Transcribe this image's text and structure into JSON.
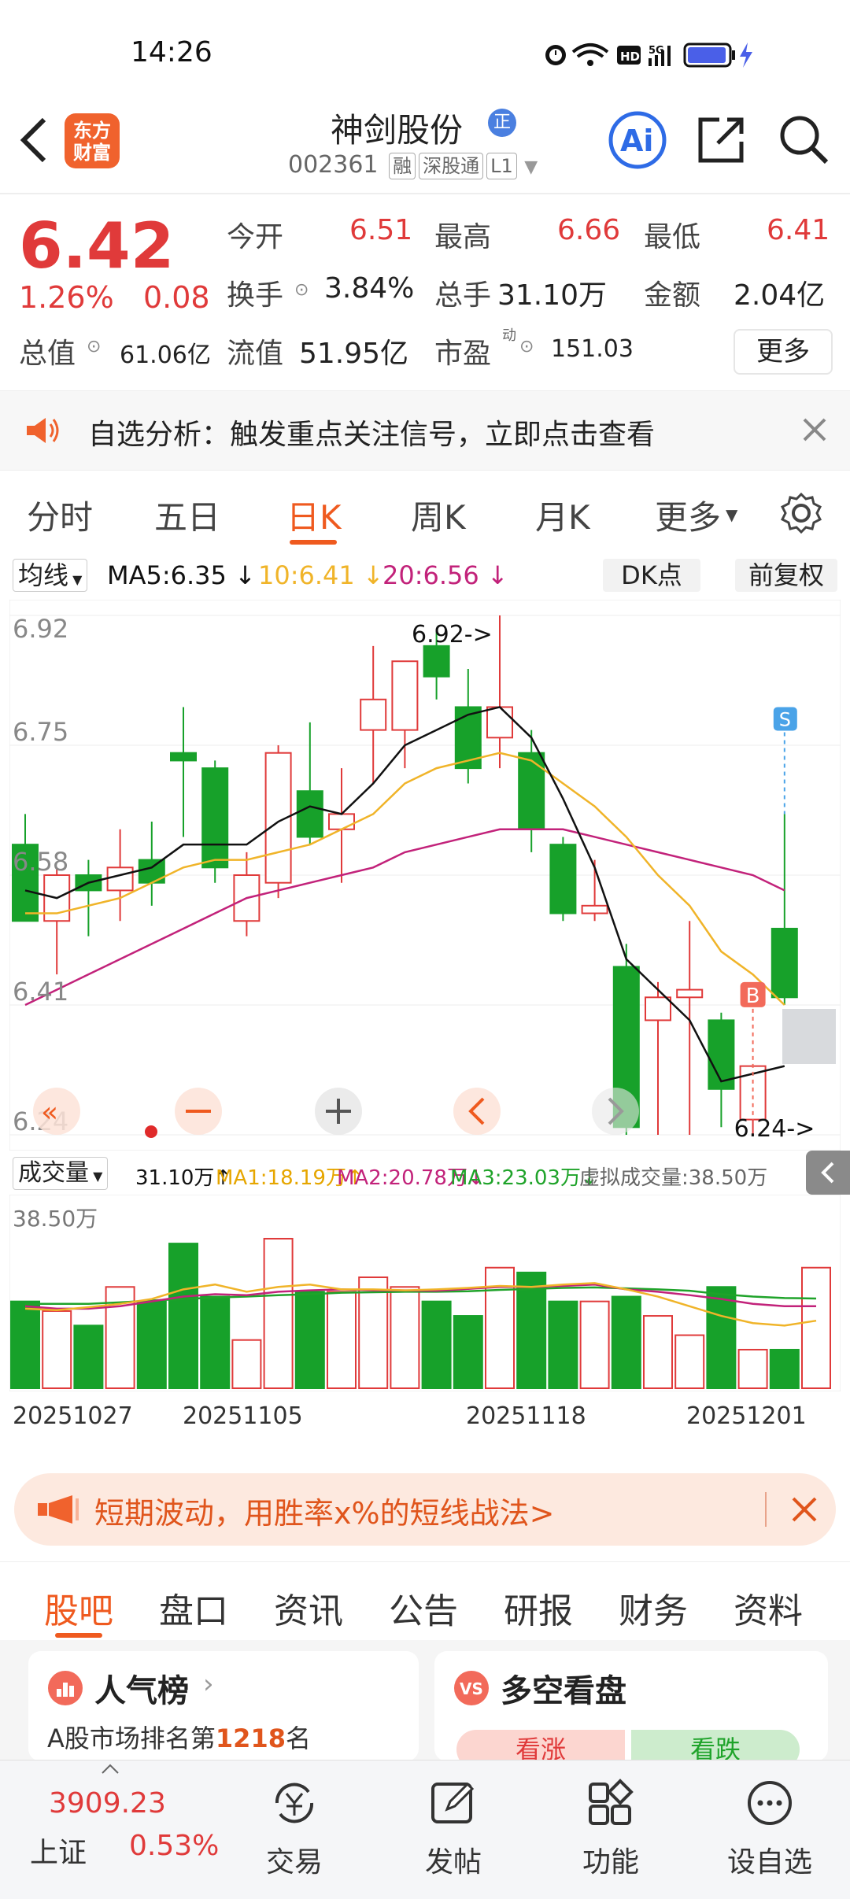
{
  "status_bar": {
    "time": "14:26"
  },
  "header": {
    "logo_text": "东方\n财富",
    "stock_name": "神剑股份",
    "badge": "正",
    "code": "002361",
    "tags": [
      "融",
      "深股通",
      "L1"
    ]
  },
  "quote": {
    "price": "6.42",
    "change_pct": "1.26%",
    "change_abs": "0.08",
    "open_label": "今开",
    "open": "6.51",
    "high_label": "最高",
    "high": "6.66",
    "low_label": "最低",
    "low": "6.41",
    "turnover_label": "换手",
    "turnover": "3.84%",
    "volume_label": "总手",
    "volume": "31.10万",
    "amount_label": "金额",
    "amount": "2.04亿",
    "mktcap_label": "总值",
    "mktcap": "61.06亿",
    "float_label": "流值",
    "float": "51.95亿",
    "pe_label": "市盈",
    "pe_sup": "动",
    "pe": "151.03",
    "more": "更多"
  },
  "banner": {
    "text": "自选分析：触发重点关注信号，立即点击查看"
  },
  "chart_tabs": [
    "分时",
    "五日",
    "日K",
    "周K",
    "月K",
    "更多"
  ],
  "ma_bar": {
    "selector": "均线",
    "ma5": "MA5:6.35",
    "ma10": "10:6.41",
    "ma20": "20:6.56",
    "dk": "DK点",
    "adjust": "前复权"
  },
  "chart_data": {
    "type": "candlestick",
    "y_ticks": [
      "6.92",
      "6.75",
      "6.58",
      "6.41",
      "6.24"
    ],
    "ylim": [
      6.24,
      6.92
    ],
    "annotations": {
      "high": "6.92->",
      "low": "6.24->",
      "buy": "B",
      "sell": "S"
    },
    "candles": [
      {
        "o": 6.62,
        "h": 6.66,
        "l": 6.55,
        "c": 6.52
      },
      {
        "o": 6.52,
        "h": 6.59,
        "l": 6.45,
        "c": 6.58
      },
      {
        "o": 6.58,
        "h": 6.6,
        "l": 6.5,
        "c": 6.56
      },
      {
        "o": 6.56,
        "h": 6.64,
        "l": 6.52,
        "c": 6.59
      },
      {
        "o": 6.6,
        "h": 6.65,
        "l": 6.54,
        "c": 6.57
      },
      {
        "o": 6.74,
        "h": 6.8,
        "l": 6.63,
        "c": 6.73
      },
      {
        "o": 6.72,
        "h": 6.73,
        "l": 6.57,
        "c": 6.59
      },
      {
        "o": 6.52,
        "h": 6.61,
        "l": 6.5,
        "c": 6.58
      },
      {
        "o": 6.57,
        "h": 6.75,
        "l": 6.55,
        "c": 6.74
      },
      {
        "o": 6.69,
        "h": 6.78,
        "l": 6.62,
        "c": 6.63
      },
      {
        "o": 6.64,
        "h": 6.72,
        "l": 6.57,
        "c": 6.66
      },
      {
        "o": 6.77,
        "h": 6.88,
        "l": 6.7,
        "c": 6.81
      },
      {
        "o": 6.77,
        "h": 6.85,
        "l": 6.72,
        "c": 6.86
      },
      {
        "o": 6.88,
        "h": 6.9,
        "l": 6.81,
        "c": 6.84
      },
      {
        "o": 6.8,
        "h": 6.85,
        "l": 6.7,
        "c": 6.72
      },
      {
        "o": 6.76,
        "h": 6.92,
        "l": 6.72,
        "c": 6.8
      },
      {
        "o": 6.74,
        "h": 6.77,
        "l": 6.61,
        "c": 6.64
      },
      {
        "o": 6.62,
        "h": 6.63,
        "l": 6.52,
        "c": 6.53
      },
      {
        "o": 6.53,
        "h": 6.6,
        "l": 6.52,
        "c": 6.54
      },
      {
        "o": 6.46,
        "h": 6.49,
        "l": 6.24,
        "c": 6.25
      },
      {
        "o": 6.39,
        "h": 6.44,
        "l": 6.24,
        "c": 6.42
      },
      {
        "o": 6.42,
        "h": 6.52,
        "l": 6.24,
        "c": 6.43
      },
      {
        "o": 6.39,
        "h": 6.4,
        "l": 6.25,
        "c": 6.3
      },
      {
        "o": 6.26,
        "h": 6.33,
        "l": 6.24,
        "c": 6.33
      },
      {
        "o": 6.51,
        "h": 6.66,
        "l": 6.41,
        "c": 6.42
      }
    ],
    "ma5": [
      6.56,
      6.55,
      6.57,
      6.58,
      6.59,
      6.62,
      6.62,
      6.62,
      6.65,
      6.67,
      6.66,
      6.7,
      6.75,
      6.77,
      6.79,
      6.8,
      6.76,
      6.68,
      6.59,
      6.47,
      6.43,
      6.39,
      6.31,
      6.32,
      6.33
    ],
    "ma10": [
      6.53,
      6.53,
      6.54,
      6.55,
      6.57,
      6.59,
      6.6,
      6.6,
      6.61,
      6.62,
      6.64,
      6.66,
      6.7,
      6.72,
      6.73,
      6.74,
      6.73,
      6.7,
      6.67,
      6.63,
      6.58,
      6.54,
      6.48,
      6.45,
      6.41
    ],
    "ma20": [
      6.41,
      6.43,
      6.45,
      6.47,
      6.49,
      6.51,
      6.53,
      6.55,
      6.56,
      6.57,
      6.58,
      6.59,
      6.61,
      6.62,
      6.63,
      6.64,
      6.64,
      6.64,
      6.63,
      6.62,
      6.61,
      6.6,
      6.59,
      6.58,
      6.56
    ],
    "volume": {
      "label": "成交量",
      "current": "31.10万",
      "ma1": "MA1:18.19万",
      "ma2": "MA2:20.78万",
      "ma3": "MA3:23.03万",
      "virtual": "虚拟成交量:38.50万",
      "max_label": "38.50万",
      "values": [
        18,
        16,
        13,
        21,
        18,
        30,
        19,
        10,
        31,
        20,
        20,
        23,
        21,
        18,
        15,
        25,
        24,
        18,
        18,
        19,
        15,
        11,
        21,
        8,
        8,
        25
      ],
      "ma_a": [
        16.5,
        16.2,
        16.8,
        17.5,
        18.5,
        20.5,
        21.5,
        20,
        21,
        21.5,
        20.5,
        20.5,
        20.3,
        20.5,
        20.8,
        21.2,
        21,
        21.5,
        21.8,
        20.5,
        19,
        17,
        15,
        13.5,
        13,
        14
      ],
      "ma_b": [
        17,
        16.5,
        16.5,
        17,
        18,
        19,
        19.5,
        19.3,
        20,
        20.3,
        20.5,
        20.3,
        20.3,
        20.2,
        20.6,
        21,
        21,
        21.2,
        21.5,
        20.5,
        20,
        19.3,
        18.5,
        17.5,
        17,
        17
      ],
      "ma_c": [
        17.5,
        17.5,
        17.5,
        17.8,
        18.2,
        18.5,
        18.8,
        19,
        19.3,
        19.5,
        19.8,
        19.9,
        20,
        20,
        20.1,
        20.4,
        20.6,
        20.8,
        20.9,
        20.7,
        20.5,
        20.2,
        19.5,
        19,
        18.7,
        18.6
      ]
    },
    "x_ticks": [
      "20251027",
      "20251105",
      "20251118",
      "20251201"
    ]
  },
  "promo": {
    "text": "短期波动，用胜率x%的短线战法>"
  },
  "info_tabs": [
    "股吧",
    "盘口",
    "资讯",
    "公告",
    "研报",
    "财务",
    "资料"
  ],
  "cards": {
    "left_title": "人气榜",
    "left_sub_prefix": "A股市场排名第",
    "left_rank": "1218",
    "left_sub_suffix": "名",
    "right_title": "多空看盘",
    "right_up": "看涨",
    "right_down": "看跌"
  },
  "bottom_nav": {
    "index_value": "3909.23",
    "index_name": "上证",
    "index_pct": "0.53%",
    "items": [
      "交易",
      "发帖",
      "功能",
      "设自选"
    ]
  },
  "colors": {
    "up": "#e03a3a",
    "down": "#17a12a",
    "accent": "#ef5a1f",
    "ma5": "#111111",
    "ma10": "#f0b429",
    "ma20": "#c2227a"
  }
}
